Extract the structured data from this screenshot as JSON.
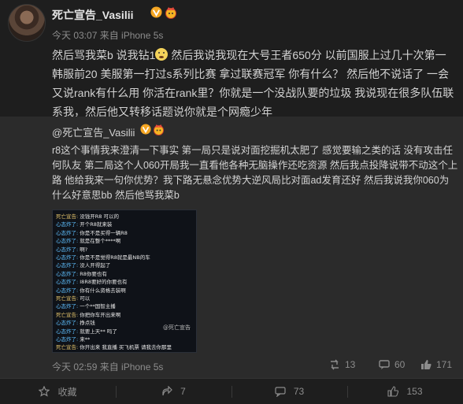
{
  "post": {
    "username": "死亡宣告_Vasilii",
    "meta": "今天 03:07 来自 iPhone 5s",
    "text_part1": "然后骂我菜b 说我钻1",
    "text_part2": " 然后我说我现在大号王者650分 以前国服上过几十次第一 韩服前20 美服第一打过s系列比赛 拿过联赛冠军 你有什么？ 然后他不说话了 一会又说rank有什么用 你活在rank里？你就是一个没战队要的垃圾 我说现在很多队伍联系我，然后他又转移话题说你就是个网瘾少年"
  },
  "repost": {
    "username": "@死亡宣告_Vasilii",
    "text": "r8这个事情我来澄清一下事实 第一局只是说对面挖掘机太肥了 感觉要输之类的话 没有攻击任何队友 第二局这个人060开局我一直看他各种无脑操作还吃资源 然后我点投降说带不动这个上路 他给我来一句你优势？我下路无悬念优势大逆风局比对面ad发育还好 然后我说我你060为什么好意思bb 然后他骂我菜b",
    "chat_lines": [
      {
        "name": "死亡宣告:",
        "text": "没钱开R8 可以的",
        "me": true
      },
      {
        "name": "心态炸了:",
        "text": "开个R8就来装",
        "me": false
      },
      {
        "name": "心态炸了:",
        "text": "你是不是买得一辆R8",
        "me": false
      },
      {
        "name": "心态炸了:",
        "text": "就是在整个****啊",
        "me": false
      },
      {
        "name": "心态炸了:",
        "text": "啊?",
        "me": false
      },
      {
        "name": "心态炸了:",
        "text": "你是不是觉得R8就是最NB的车",
        "me": false
      },
      {
        "name": "心态炸了:",
        "text": "没人开得起了",
        "me": false
      },
      {
        "name": "心态炸了:",
        "text": "R8你要也有",
        "me": false
      },
      {
        "name": "心态炸了:",
        "text": "I8R8要好的你要也有",
        "me": false
      },
      {
        "name": "心态炸了:",
        "text": "你有什么资格去装啊",
        "me": false
      },
      {
        "name": "死亡宣告:",
        "text": "可以",
        "me": true
      },
      {
        "name": "心态炸了:",
        "text": "一个**国智主播",
        "me": false
      },
      {
        "name": "死亡宣告:",
        "text": "你把你车开出来啊",
        "me": true
      },
      {
        "name": "心态炸了:",
        "text": "挣点钱",
        "me": false
      },
      {
        "name": "心态炸了:",
        "text": "就要上天** 吗了",
        "me": false
      },
      {
        "name": "心态炸了:",
        "text": "来**",
        "me": false
      },
      {
        "name": "死亡宣告:",
        "text": "你开出来 我直播 买飞机票 请我去你那里",
        "me": true
      }
    ],
    "watermark": "@死亡宣告",
    "time": "今天 02:59 来自 iPhone 5s",
    "reposts": "13",
    "comments": "60",
    "likes": "171"
  },
  "actions": {
    "favorite": "收藏",
    "share": "7",
    "comment": "73",
    "like": "153"
  }
}
